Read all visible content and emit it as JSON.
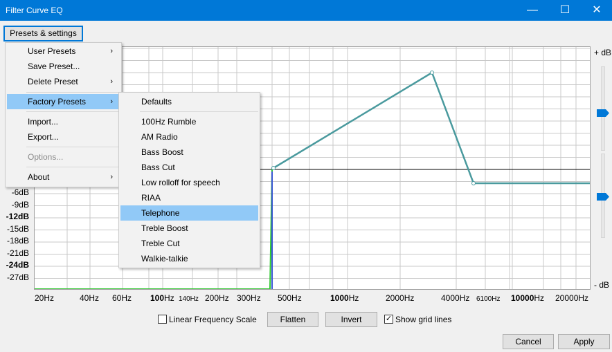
{
  "window": {
    "title": "Filter Curve EQ",
    "min_glyph": "—",
    "max_glyph": "☐",
    "close_glyph": "✕"
  },
  "presets_button": "Presets & settings",
  "menu": {
    "items": [
      "User Presets",
      "Save Preset...",
      "Delete Preset",
      "Factory Presets",
      "Import...",
      "Export...",
      "Options...",
      "About"
    ],
    "arrow": "›"
  },
  "factory_presets": [
    "Defaults",
    "100Hz Rumble",
    "AM Radio",
    "Bass Boost",
    "Bass Cut",
    "Low rolloff for speech",
    "RIAA",
    "Telephone",
    "Treble Boost",
    "Treble Cut",
    "Walkie-talkie"
  ],
  "graph": {
    "db_labels": [
      "-6dB",
      "-9dB",
      "-12dB",
      "-15dB",
      "-18dB",
      "-21dB",
      "-24dB",
      "-27dB"
    ],
    "db_bold": [
      false,
      false,
      true,
      false,
      false,
      false,
      true,
      false
    ],
    "freq_labels": [
      {
        "text": "20Hz"
      },
      {
        "text": "40Hz"
      },
      {
        "text": "60Hz"
      },
      {
        "bold": "100",
        "rest": "Hz"
      },
      {
        "small": "140Hz"
      },
      {
        "text": "200Hz"
      },
      {
        "text": "300Hz"
      },
      {
        "text": "500Hz"
      },
      {
        "bold": "1000",
        "rest": "Hz"
      },
      {
        "text": "2000Hz"
      },
      {
        "text": "4000Hz"
      },
      {
        "small": "6100Hz"
      },
      {
        "bold": "10000",
        "rest": "Hz"
      },
      {
        "text": "20000Hz"
      }
    ],
    "plus_db": "+ dB",
    "minus_db": "- dB",
    "curve_color": "#4a9a9e",
    "floor_color": "#2ec82e"
  },
  "bottom": {
    "linear_label": "Linear Frequency Scale",
    "linear_checked": false,
    "flatten": "Flatten",
    "invert": "Invert",
    "grid_label": "Show grid lines",
    "grid_checked": true,
    "cancel": "Cancel",
    "apply": "Apply",
    "check_glyph": "✓"
  },
  "accent": "#0078d7"
}
